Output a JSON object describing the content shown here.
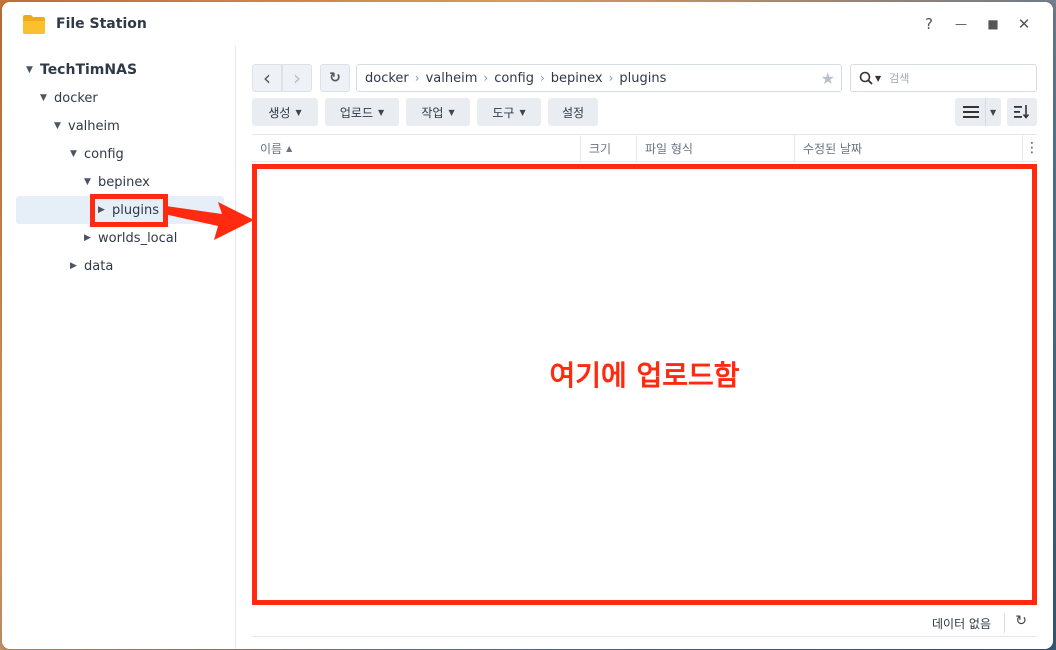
{
  "window": {
    "title": "File Station",
    "help_icon": "?",
    "minimize_icon": "—",
    "maximize_icon": "■",
    "close_icon": "✕"
  },
  "tree": {
    "root": "TechTimNAS",
    "items": [
      {
        "label": "docker"
      },
      {
        "label": "valheim"
      },
      {
        "label": "config"
      },
      {
        "label": "bepinex"
      },
      {
        "label": "plugins"
      },
      {
        "label": "worlds_local"
      },
      {
        "label": "data"
      }
    ]
  },
  "nav": {
    "back_icon": "‹",
    "forward_icon": "›",
    "refresh_icon": "↻"
  },
  "path": {
    "segments": [
      "docker",
      "valheim",
      "config",
      "bepinex",
      "plugins"
    ],
    "separator": "›",
    "star_icon": "★"
  },
  "search": {
    "placeholder": "검색"
  },
  "actions": {
    "create": "생성",
    "upload": "업로드",
    "action": "작업",
    "tools": "도구",
    "settings": "설정"
  },
  "columns": {
    "name": "이름",
    "size": "크기",
    "file_type": "파일 형식",
    "modified": "수정된 날짜"
  },
  "annotation": {
    "text": "여기에 업로드함",
    "color": "#ff2a10"
  },
  "status": {
    "text": "데이터 없음"
  }
}
